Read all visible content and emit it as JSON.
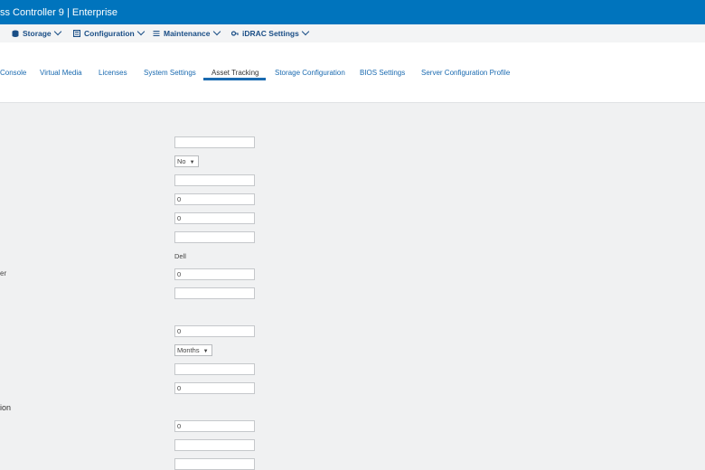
{
  "header": {
    "title": "ss Controller 9 | Enterprise"
  },
  "menu": [
    {
      "label": "Storage",
      "icon": "storage-icon"
    },
    {
      "label": "Configuration",
      "icon": "configuration-icon"
    },
    {
      "label": "Maintenance",
      "icon": "maintenance-icon"
    },
    {
      "label": "iDRAC Settings",
      "icon": "idrac-settings-icon"
    }
  ],
  "tabs": [
    {
      "label": "Console"
    },
    {
      "label": "Virtual Media"
    },
    {
      "label": "Licenses"
    },
    {
      "label": "System Settings"
    },
    {
      "label": "Asset Tracking",
      "active": true
    },
    {
      "label": "Storage Configuration"
    },
    {
      "label": "BIOS Settings"
    },
    {
      "label": "Server Configuration Profile"
    }
  ],
  "form": {
    "f1": "",
    "f2_select": "No",
    "f3": "",
    "f4": "0",
    "f5": "0",
    "f6": "",
    "f7_static": "Dell",
    "f8_label": "er",
    "f8": "0",
    "f9": "",
    "f10": "0",
    "f11_select": "Months",
    "f12": "",
    "f13": "0",
    "section_label": "ion",
    "f14": "0",
    "f15": "",
    "f16": ""
  },
  "colors": {
    "header": "#0074bd",
    "link": "#1a6ab0",
    "background": "#f0f1f2"
  }
}
